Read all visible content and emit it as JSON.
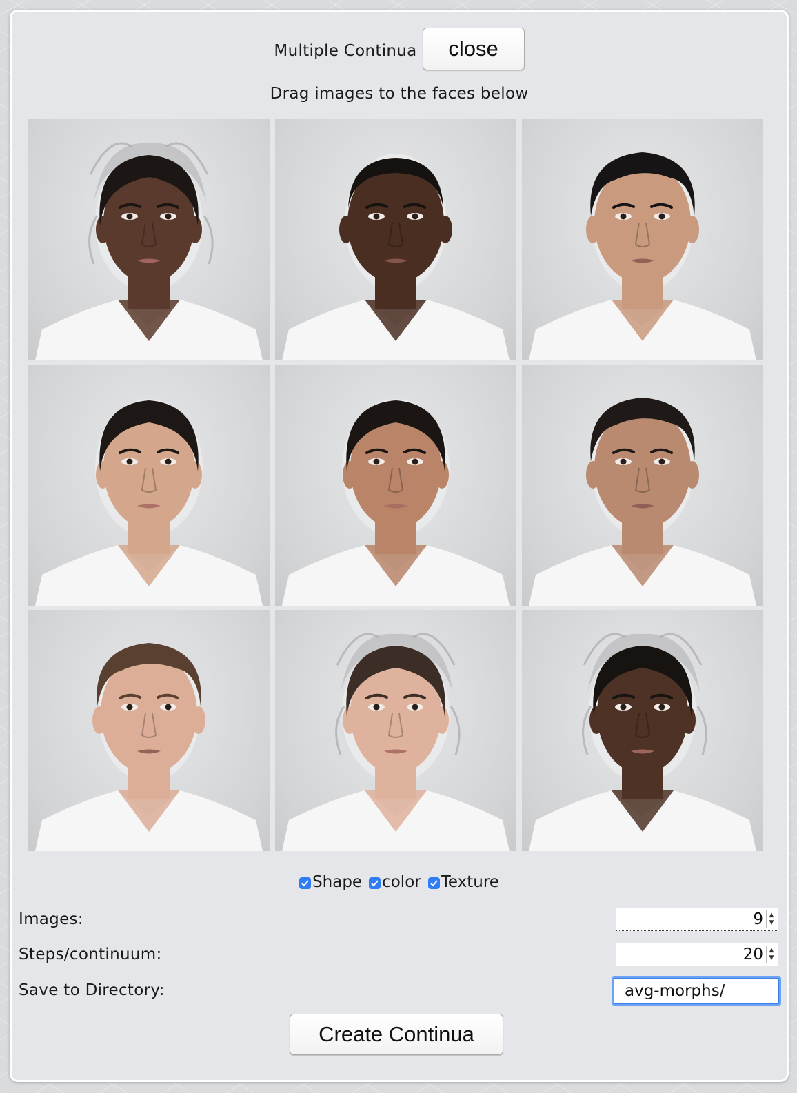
{
  "dialog": {
    "title": "Multiple Continua",
    "close_label": "close",
    "instruction": "Drag images to the faces below"
  },
  "faces": [
    {
      "id": "face-1",
      "skin": "#5a3a2c",
      "hair": "#1c1614",
      "hair_style": "updo",
      "gender": "female"
    },
    {
      "id": "face-2",
      "skin": "#4a2e22",
      "hair": "#161210",
      "hair_style": "buzz",
      "gender": "male"
    },
    {
      "id": "face-3",
      "skin": "#c99a7d",
      "hair": "#161414",
      "hair_style": "short",
      "gender": "male"
    },
    {
      "id": "face-4",
      "skin": "#d4a78c",
      "hair": "#1d1816",
      "hair_style": "pulled-back",
      "gender": "female"
    },
    {
      "id": "face-5",
      "skin": "#b98468",
      "hair": "#1b1513",
      "hair_style": "pulled-back",
      "gender": "female"
    },
    {
      "id": "face-6",
      "skin": "#b98a70",
      "hair": "#1f1a18",
      "hair_style": "short",
      "gender": "male"
    },
    {
      "id": "face-7",
      "skin": "#dcae98",
      "hair": "#5a4030",
      "hair_style": "short",
      "gender": "male"
    },
    {
      "id": "face-8",
      "skin": "#dfb29d",
      "hair": "#3c2d26",
      "hair_style": "updo",
      "gender": "female"
    },
    {
      "id": "face-9",
      "skin": "#4e3226",
      "hair": "#171311",
      "hair_style": "updo",
      "gender": "female"
    }
  ],
  "options": {
    "shape_label": "Shape",
    "shape_checked": true,
    "color_label": "color",
    "color_checked": true,
    "texture_label": "Texture",
    "texture_checked": true
  },
  "form": {
    "images_label": "Images:",
    "images_value": "9",
    "steps_label": "Steps/continuum:",
    "steps_value": "20",
    "directory_label": "Save to Directory:",
    "directory_value": "avg-morphs/"
  },
  "create_label": "Create Continua",
  "colors": {
    "dialog_bg": "#e4e6e9",
    "checkbox_blue": "#2f7df6",
    "focus_ring": "#6aa2f5"
  }
}
